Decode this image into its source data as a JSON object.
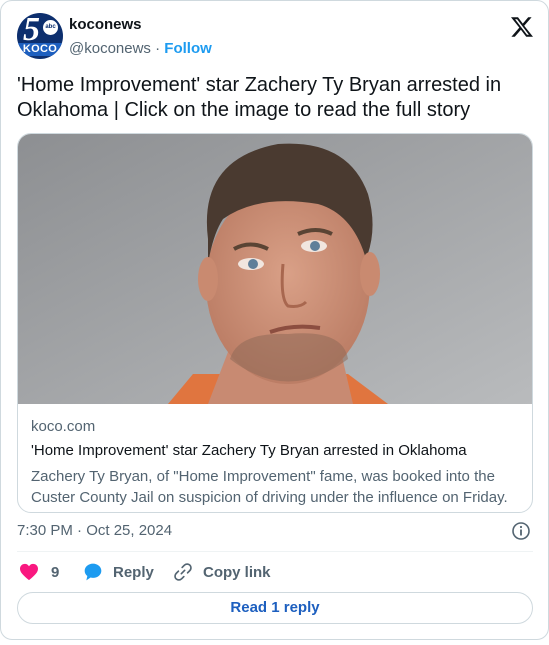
{
  "author": {
    "name": "koconews",
    "handle": "@koconews",
    "separator": "·",
    "follow_label": "Follow",
    "avatar_text": {
      "number": "5",
      "network": "abc",
      "station": "KOCO"
    }
  },
  "tweet": {
    "text": "'Home Improvement' star Zachery Ty Bryan arrested in Oklahoma | Click on the image to read the full story",
    "timestamp": "7:30 PM · Oct 25, 2024"
  },
  "link_card": {
    "domain": "koco.com",
    "title": "'Home Improvement' star Zachery Ty Bryan arrested in Oklahoma",
    "description": "Zachery Ty Bryan, of \"Home Improvement\" fame, was booked into the Custer County Jail on suspicion of driving under the influence on Friday."
  },
  "actions": {
    "like_count": "9",
    "reply_label": "Reply",
    "copy_link_label": "Copy link"
  },
  "read_replies_label": "Read 1 reply",
  "icons": [
    "x-logo-icon",
    "info-icon",
    "heart-icon",
    "reply-bubble-icon",
    "link-icon"
  ],
  "colors": {
    "accent": "#1d9bf0",
    "like": "#f91880",
    "text_primary": "#0f1419",
    "text_secondary": "#536471",
    "border": "#cfd9de"
  }
}
